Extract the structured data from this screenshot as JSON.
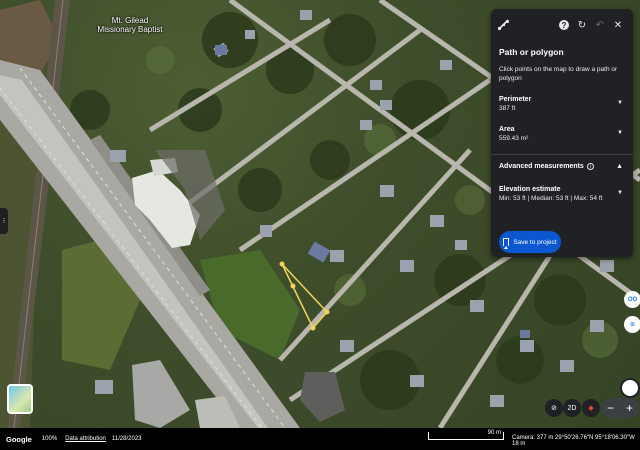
{
  "map": {
    "labels": {
      "church": "Mt. Gilead\nMissionary Baptist"
    }
  },
  "panel": {
    "title": "Path or polygon",
    "subtitle": "Click points on the map to draw a path or polygon",
    "icons": [
      "ruler-icon",
      "help-icon",
      "refresh-icon",
      "undo-icon",
      "close-icon"
    ],
    "perimeter": {
      "label": "Perimeter",
      "value": "387 ft"
    },
    "area": {
      "label": "Area",
      "value": "559.43 m²"
    },
    "advanced": {
      "label": "Advanced measurements"
    },
    "elevation": {
      "label": "Elevation estimate",
      "value": "Min: 53 ft | Median: 53 ft | Max: 54 ft"
    },
    "save_label": "Save to project"
  },
  "controls": {
    "view_2d": "2D",
    "zoom_in": "+",
    "zoom_out": "−",
    "side_icon_1": "OO",
    "side_icon_2": "⊙"
  },
  "status": {
    "brand": "Google",
    "zoom": "100%",
    "data_attribution": "Data attribution",
    "date": "11/28/2023",
    "scale_label": "90 m",
    "camera": "Camera: 377 m    29°50'26.76\"N 95°18'06.30\"W  18 m"
  },
  "colors": {
    "panel_bg": "#202124",
    "accent": "#0b57d0",
    "polygon": "#f3d35a"
  }
}
